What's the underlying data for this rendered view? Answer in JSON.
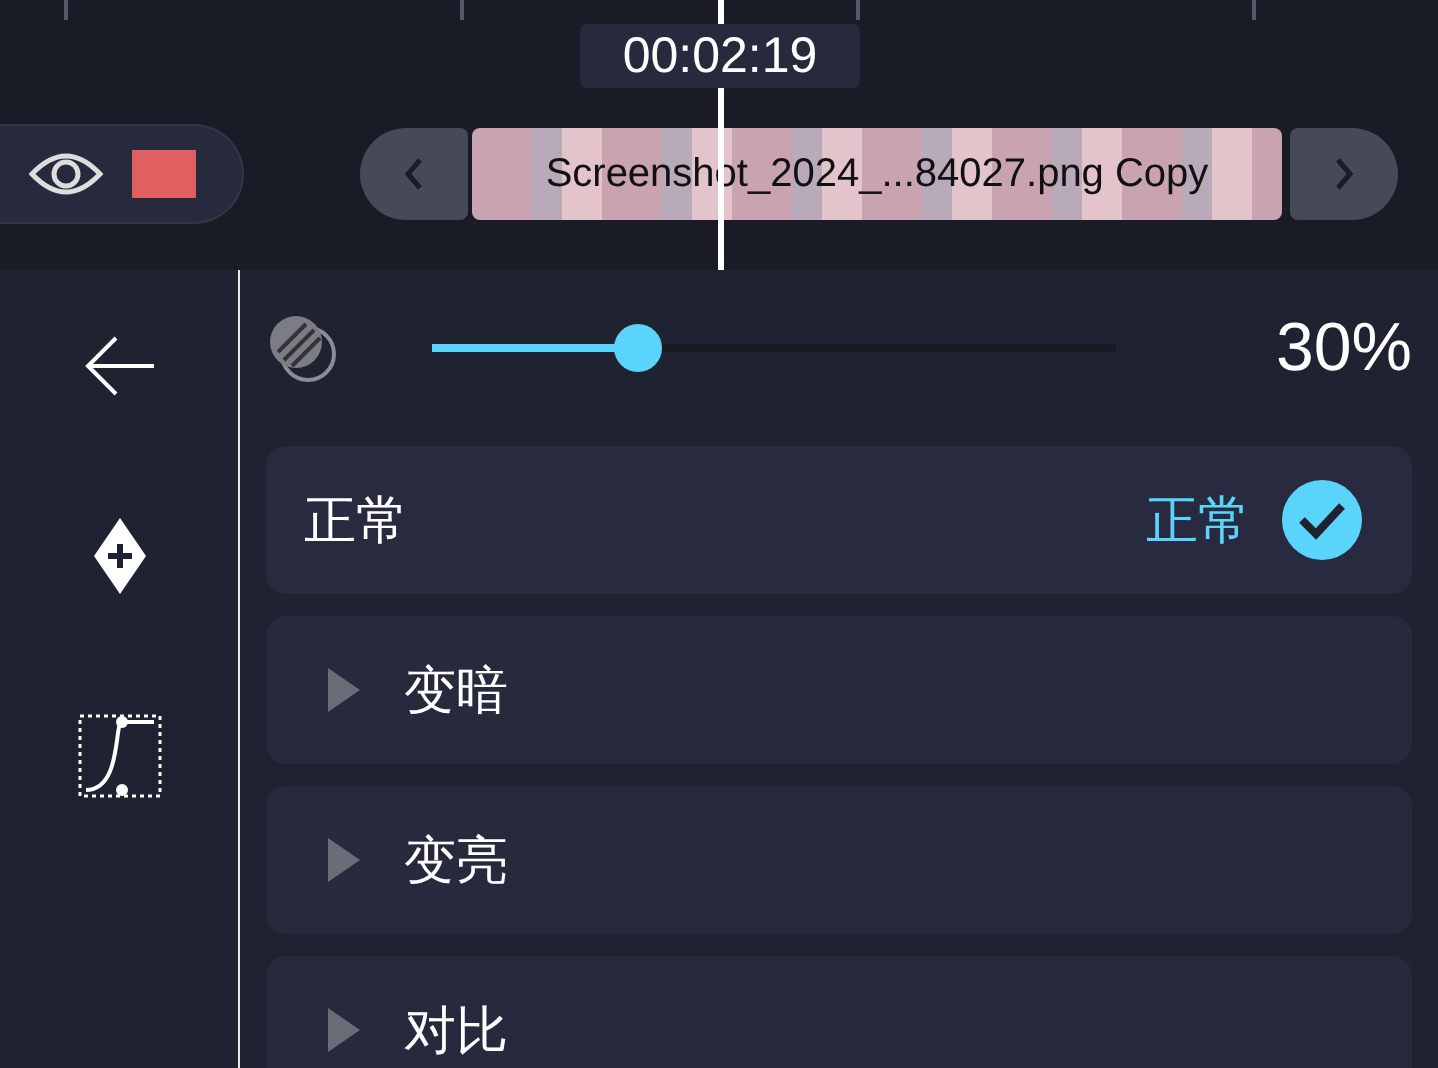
{
  "timeline": {
    "time": "00:02:19",
    "clip": {
      "name": "Screenshot_2024_...84027.png Copy"
    }
  },
  "opacity": {
    "level": 0.3,
    "reading": "30%"
  },
  "blend_modes": [
    {
      "kind": "current",
      "label": "正常",
      "value": "正常",
      "selected": true
    },
    {
      "kind": "group",
      "label": "变暗",
      "expanded": false
    },
    {
      "kind": "group",
      "label": "变亮",
      "expanded": false
    },
    {
      "kind": "group",
      "label": "对比",
      "expanded": false
    }
  ]
}
